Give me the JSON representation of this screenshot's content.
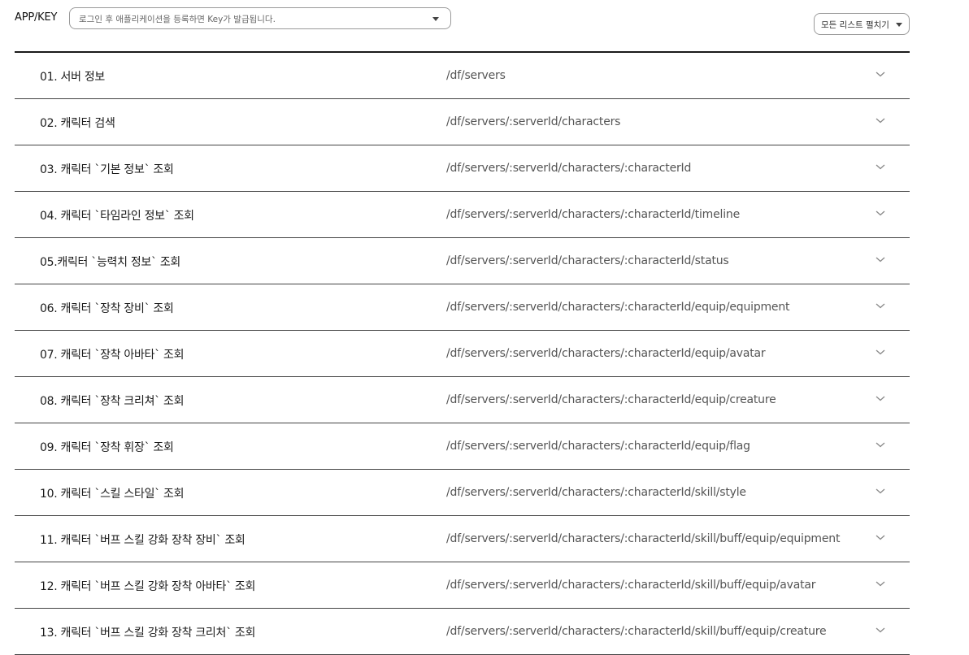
{
  "header": {
    "appkey_label": "APP/KEY",
    "appkey_placeholder": "로그인 후 애플리케이션을 등록하면 Key가 발급됩니다.",
    "expand_all_label": "모든 리스트 펼치기"
  },
  "apis": [
    {
      "title": "01. 서버 정보",
      "path": "/df/servers"
    },
    {
      "title": "02. 캐릭터 검색",
      "path": "/df/servers/:serverId/characters"
    },
    {
      "title": "03. 캐릭터 `기본 정보` 조회",
      "path": "/df/servers/:serverId/characters/:characterId"
    },
    {
      "title": "04. 캐릭터 `타임라인 정보` 조회",
      "path": "/df/servers/:serverId/characters/:characterId/timeline"
    },
    {
      "title": "05.캐릭터 `능력치 정보` 조회",
      "path": "/df/servers/:serverId/characters/:characterId/status"
    },
    {
      "title": "06. 캐릭터 `장착 장비` 조회",
      "path": "/df/servers/:serverId/characters/:characterId/equip/equipment"
    },
    {
      "title": "07. 캐릭터 `장착 아바타` 조회",
      "path": "/df/servers/:serverId/characters/:characterId/equip/avatar"
    },
    {
      "title": "08. 캐릭터 `장착 크리쳐` 조회",
      "path": "/df/servers/:serverId/characters/:characterId/equip/creature"
    },
    {
      "title": "09. 캐릭터 `장착 휘장` 조회",
      "path": "/df/servers/:serverId/characters/:characterId/equip/flag"
    },
    {
      "title": "10. 캐릭터 `스킬 스타일` 조회",
      "path": "/df/servers/:serverId/characters/:characterId/skill/style"
    },
    {
      "title": "11. 캐릭터 `버프 스킬 강화 장착 장비` 조회",
      "path": "/df/servers/:serverId/characters/:characterId/skill/buff/equip/equipment"
    },
    {
      "title": "12. 캐릭터 `버프 스킬 강화 장착 아바타` 조회",
      "path": "/df/servers/:serverId/characters/:characterId/skill/buff/equip/avatar"
    },
    {
      "title": "13. 캐릭터 `버프 스킬 강화 장착 크리처` 조회",
      "path": "/df/servers/:serverId/characters/:characterId/skill/buff/equip/creature"
    }
  ]
}
